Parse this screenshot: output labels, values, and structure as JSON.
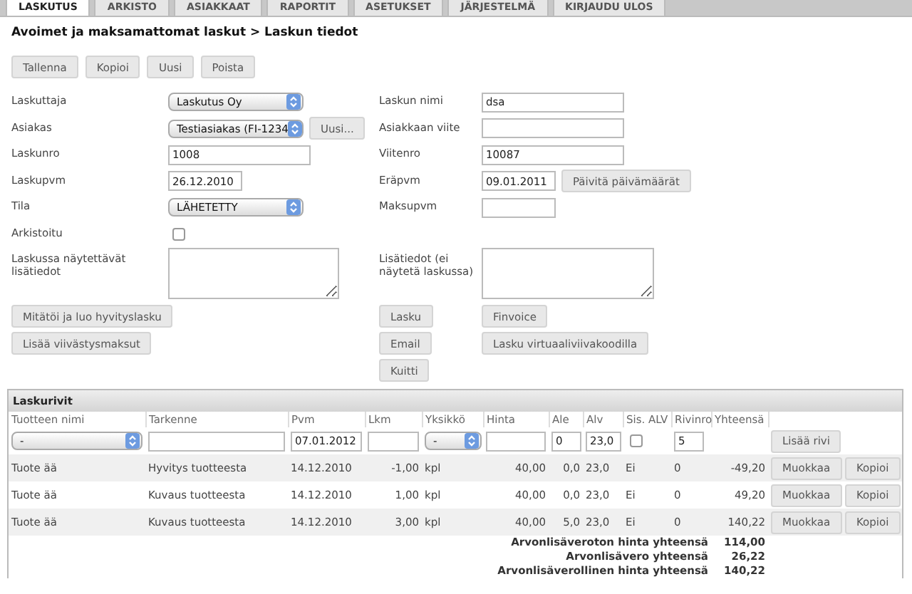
{
  "tabs": [
    {
      "label": "LASKUTUS",
      "selected": true
    },
    {
      "label": "ARKISTO",
      "selected": false
    },
    {
      "label": "ASIAKKAAT",
      "selected": false
    },
    {
      "label": "RAPORTIT",
      "selected": false
    },
    {
      "label": "ASETUKSET",
      "selected": false
    },
    {
      "label": "JÄRJESTELMÄ",
      "selected": false
    },
    {
      "label": "KIRJAUDU ULOS",
      "selected": false
    }
  ],
  "breadcrumb": "Avoimet ja maksamattomat laskut > Laskun tiedot",
  "toolbar": [
    "Tallenna",
    "Kopioi",
    "Uusi",
    "Poista"
  ],
  "form_rows": [
    {
      "left": {
        "label": "Laskuttaja",
        "kind": "select",
        "value": "Laskutus Oy"
      },
      "right": {
        "label": "Laskun nimi",
        "kind": "text",
        "value": "dsa"
      }
    },
    {
      "left": {
        "label": "Asiakas",
        "kind": "select",
        "value": "Testiasiakas (FI-1234",
        "button": "Uusi..."
      },
      "right": {
        "label": "Asiakkaan viite",
        "kind": "text"
      }
    },
    {
      "left": {
        "label": "Laskunro",
        "kind": "text",
        "value": "1008"
      },
      "right": {
        "label": "Viitenro",
        "kind": "text",
        "value": "10087"
      }
    },
    {
      "left": {
        "label": "Laskupvm",
        "kind": "date",
        "value": "26.12.2010"
      },
      "right": {
        "label": "Eräpvm",
        "kind": "date",
        "value": "09.01.2011",
        "button": "Päivitä päivämäärät"
      }
    },
    {
      "left": {
        "label": "Tila",
        "kind": "select",
        "value": "LÄHETETTY"
      },
      "right": {
        "label": "Maksupvm",
        "kind": "date"
      }
    },
    {
      "left": {
        "label": "Arkistoitu",
        "kind": "checkbox",
        "checked": false
      }
    },
    {
      "left": {
        "label": "Laskussa näytettävät lisätiedot",
        "kind": "textarea"
      },
      "right": {
        "label": "Lisätiedot (ei näytetä laskussa)",
        "kind": "textarea"
      }
    }
  ],
  "action_rows": [
    {
      "left": "Mitätöi ja luo hyvityslasku",
      "right": [
        "Lasku",
        "Finvoice"
      ]
    },
    {
      "left": "Lisää viivästysmaksut",
      "right": [
        "Email",
        "Lasku virtuaaliviivakoodilla"
      ]
    },
    {
      "right": [
        "Kuitti"
      ]
    }
  ],
  "table": {
    "title": "Laskurivit",
    "columns": [
      "Tuotteen nimi",
      "Tarkenne",
      "Pvm",
      "Lkm",
      "Yksikkö",
      "Hinta",
      "Ale",
      "Alv",
      "Sis. ALV",
      "Rivinro",
      "Yhteensä"
    ],
    "entry": {
      "product": "-",
      "date": "07.01.2012",
      "unit": "-",
      "discount": "0",
      "vat": "23,0",
      "vat_included": false,
      "row_number": "5",
      "button": "Lisää rivi"
    },
    "rows": [
      {
        "cells": [
          "Tuote ää",
          "Hyvitys tuotteesta",
          "14.12.2010",
          "-1,00",
          "kpl",
          "40,00",
          "0,0",
          "23,0",
          "Ei",
          "0",
          "-49,20"
        ],
        "buttons": [
          "Muokkaa",
          "Kopioi"
        ]
      },
      {
        "cells": [
          "Tuote ää",
          "Kuvaus tuotteesta",
          "14.12.2010",
          "1,00",
          "kpl",
          "40,00",
          "0,0",
          "23,0",
          "Ei",
          "0",
          "49,20"
        ],
        "buttons": [
          "Muokkaa",
          "Kopioi"
        ]
      },
      {
        "cells": [
          "Tuote ää",
          "Kuvaus tuotteesta",
          "14.12.2010",
          "3,00",
          "kpl",
          "40,00",
          "5,0",
          "23,0",
          "Ei",
          "0",
          "140,22"
        ],
        "buttons": [
          "Muokkaa",
          "Kopioi"
        ]
      }
    ],
    "totals": [
      {
        "label": "Arvonlisäveroton hinta yhteensä",
        "value": "114,00"
      },
      {
        "label": "Arvonlisävero yhteensä",
        "value": "26,22"
      },
      {
        "label": "Arvonlisäverollinen hinta yhteensä",
        "value": "140,22"
      }
    ]
  }
}
